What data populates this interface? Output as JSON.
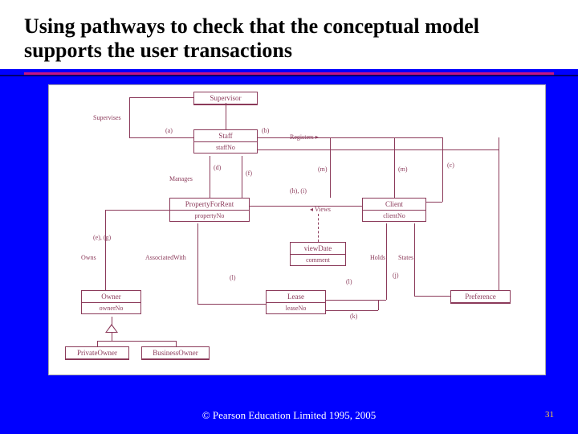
{
  "title": "Using pathways to check that the conceptual model supports the user transactions",
  "footer": "© Pearson Education Limited 1995, 2005",
  "pagenum": "31",
  "entities": {
    "supervisor": "Supervisor",
    "staff": "Staff",
    "staff_attr": "staffNo",
    "pfr": "PropertyForRent",
    "pfr_attr": "propertyNo",
    "client": "Client",
    "client_attr": "clientNo",
    "viewdate": "viewDate",
    "viewdate_attr": "comment",
    "owner": "Owner",
    "owner_attr": "ownerNo",
    "lease": "Lease",
    "lease_attr": "leaseNo",
    "preference": "Preference",
    "private": "PrivateOwner",
    "business": "BusinessOwner"
  },
  "labels": {
    "supervises": "Supervises",
    "a": "(a)",
    "b": "(b)",
    "registers": "Registers ▸",
    "c": "(c)",
    "d": "(d)",
    "f": "(f)",
    "m": "(m)",
    "m2": "(m)",
    "manages": "Manages",
    "hi": "(h), (i)",
    "views": "◂ Views",
    "eg": "(e), (g)",
    "owns": "Owns",
    "assoc": "AssociatedWith",
    "l": "(l)",
    "l2": "(l)",
    "holds": "Holds",
    "states": "States",
    "j": "(j)",
    "k": "(k)"
  }
}
